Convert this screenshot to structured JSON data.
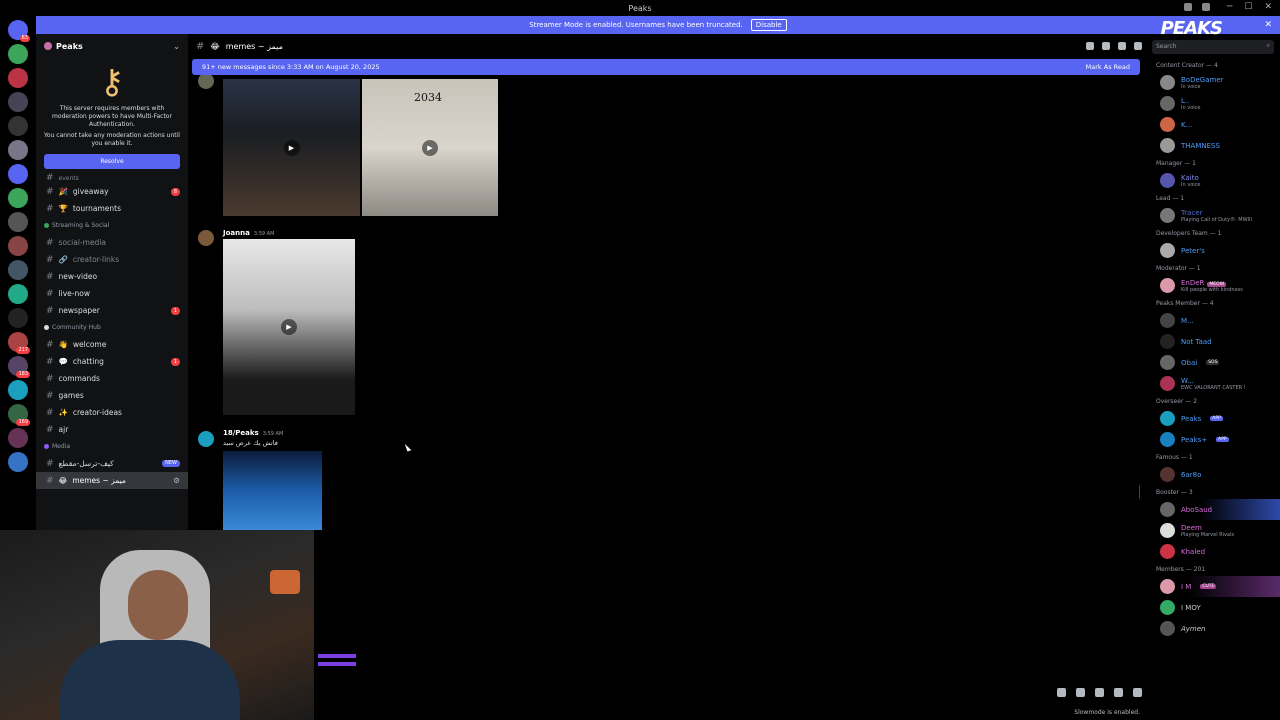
{
  "window": {
    "title": "Peaks"
  },
  "banner": {
    "text": "Streamer Mode is enabled. Usernames have been truncated.",
    "disable_label": "Disable",
    "logo_text": "PEAKS"
  },
  "guild": {
    "name": "Peaks"
  },
  "mfa": {
    "line1": "This server requires members with moderation powers to have Multi-Factor Authentication.",
    "line2": "You cannot take any moderation actions until you enable it.",
    "resolve_label": "Resolve"
  },
  "channels": {
    "events": "events",
    "giveaway": "giveaway",
    "tournaments": "tournaments",
    "cat_streaming": "Streaming & Social",
    "social_media": "social-media",
    "creator_links": "creator-links",
    "new_video": "new-video",
    "live_now": "live-now",
    "newspaper": "newspaper",
    "cat_community": "Community Hub",
    "welcome": "welcome",
    "chatting": "chatting",
    "commands": "commands",
    "games": "games",
    "creator_ideas": "creator-ideas",
    "ajr": "ajr",
    "cat_media": "Media",
    "arabic_channel": "كيف-ترسل-مقطع",
    "memes": "memes ~ ميمز",
    "new_label": "NEW",
    "badge_giveaway": "8",
    "badge_newspaper": "1",
    "badge_chatting": "1"
  },
  "header": {
    "channel": "memes ~ ميمز"
  },
  "search": {
    "placeholder": "Search"
  },
  "newbar": {
    "text": "91+ new messages since 3:33 AM on August 20, 2025",
    "mark_label": "Mark As Read"
  },
  "messages": {
    "video_caption": "2034",
    "m1_author": "Joanna",
    "m1_time": "3:59 AM",
    "m2_author": "18/Peaks",
    "m2_time": "3:59 AM",
    "m2_text": "فاتش يك عرض سيد"
  },
  "members": {
    "g_content": "Content Creator — 4",
    "bodegamer": "BoDeGamer",
    "in_voice": "In voice",
    "l_user": "L..",
    "k_user": "K...",
    "thamness": "THAMNESS",
    "g_manager": "Manager — 1",
    "kaito": "Kaito",
    "g_lead": "Lead — 1",
    "tracer": "Tracer",
    "tracer_status": "Playing Call of Duty®: MWIII",
    "g_devteam": "Developers Team — 1",
    "peters": "Peter's",
    "g_moderator": "Moderator — 1",
    "ender": "EnDeR",
    "meow": "MEOW",
    "ender_status": "Kill people with kindness",
    "g_member": "Peaks Member — 4",
    "m_user": "M...",
    "not_taad": "Not Taad",
    "obai": "Obai",
    "obai_tag": "SOS",
    "w_user": "W...",
    "w_status": "EWC VALORANT CASTER !",
    "g_overseer": "Overseer — 2",
    "peaks_bot": "Peaks",
    "peaks_plus": "Peaks+",
    "app_tag": "APP",
    "g_famous": "Famous — 1",
    "sar8o": "6ar8o",
    "g_booster": "Booster — 3",
    "abosaud": "AboSaud",
    "deem": "Deem",
    "deem_status": "Playing Marvel Rivals",
    "khaled": "Khaled",
    "g_members": "Members — 201",
    "i_m": "I M",
    "cute_tag": "CUTE",
    "moy": "I MOY",
    "aymen": "Aymen"
  },
  "footer": {
    "slowmode": "Slowmode is enabled."
  },
  "colors": {
    "accent": "#5865f2",
    "danger": "#f23f43",
    "bg": "#000000",
    "sidebar": "#111214"
  }
}
